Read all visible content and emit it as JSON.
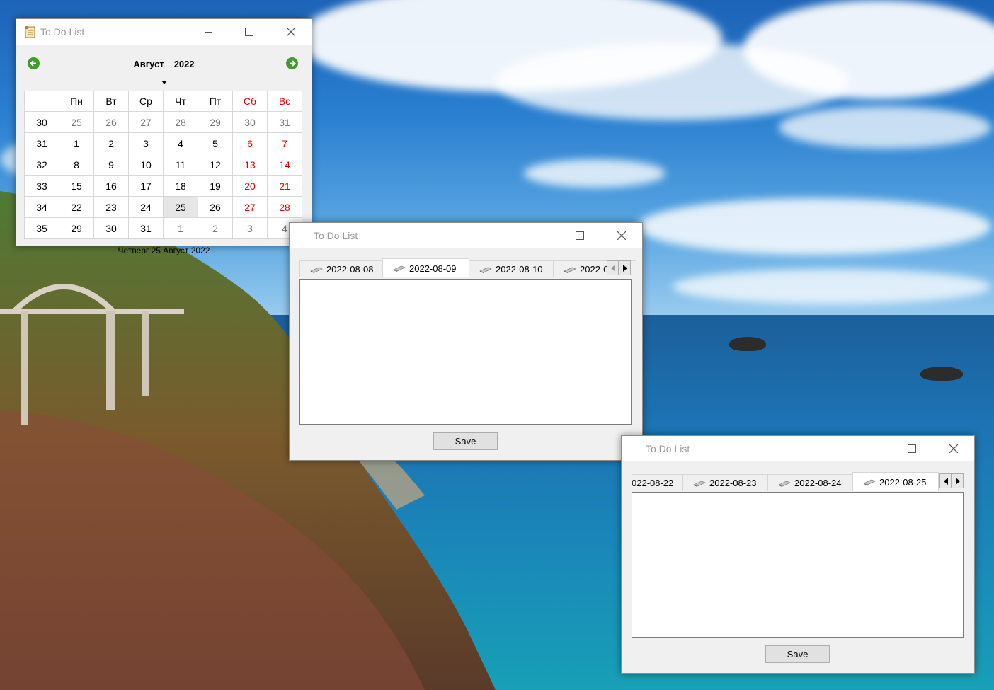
{
  "calendar_window": {
    "title": "To Do List",
    "month": "Август",
    "year": "2022",
    "weekday_headers": [
      "Пн",
      "Вт",
      "Ср",
      "Чт",
      "Пт",
      "Сб",
      "Вс"
    ],
    "weeks": [
      {
        "week": "30",
        "days": [
          "25",
          "26",
          "27",
          "28",
          "29",
          "30",
          "31"
        ]
      },
      {
        "week": "31",
        "days": [
          "1",
          "2",
          "3",
          "4",
          "5",
          "6",
          "7"
        ]
      },
      {
        "week": "32",
        "days": [
          "8",
          "9",
          "10",
          "11",
          "12",
          "13",
          "14"
        ]
      },
      {
        "week": "33",
        "days": [
          "15",
          "16",
          "17",
          "18",
          "19",
          "20",
          "21"
        ]
      },
      {
        "week": "34",
        "days": [
          "22",
          "23",
          "24",
          "25",
          "26",
          "27",
          "28"
        ]
      },
      {
        "week": "35",
        "days": [
          "29",
          "30",
          "31",
          "1",
          "2",
          "3",
          "4"
        ]
      }
    ],
    "footer": "Четверг 25 Август 2022"
  },
  "todo_window_1": {
    "title": "To Do List",
    "tabs": [
      "2022-08-08",
      "2022-08-09",
      "2022-08-10",
      "2022-0"
    ],
    "active_tab": "2022-08-09",
    "note_text": "",
    "save_label": "Save"
  },
  "todo_window_2": {
    "title": "To Do List",
    "tabs": [
      "022-08-22",
      "2022-08-23",
      "2022-08-24",
      "2022-08-25"
    ],
    "active_tab": "2022-08-25",
    "note_text": "",
    "save_label": "Save"
  },
  "colors": {
    "weekend": "#e00000",
    "other_month": "#7a7a7a",
    "nav_arrow": "#3f9b2a",
    "selected_day_bg": "#e6e6e6"
  }
}
